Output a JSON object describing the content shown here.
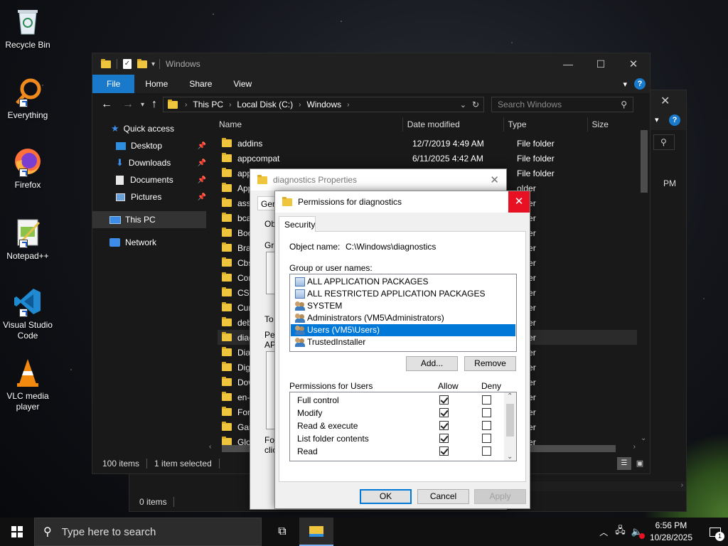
{
  "desktop": {
    "icons": [
      {
        "label": "Recycle Bin",
        "icon": "recycle-bin-icon"
      },
      {
        "label": "Everything",
        "icon": "everything-search-icon"
      },
      {
        "label": "Firefox",
        "icon": "firefox-icon"
      },
      {
        "label": "Notepad++",
        "icon": "notepadpp-icon"
      },
      {
        "label": "Visual Studio Code",
        "icon": "vscode-icon"
      },
      {
        "label": "VLC media player",
        "icon": "vlc-icon"
      }
    ]
  },
  "back_window": {
    "time_fragment": "PM",
    "status": "0 items"
  },
  "explorer": {
    "title": "Windows",
    "ribbon": {
      "file": "File",
      "home": "Home",
      "share": "Share",
      "view": "View"
    },
    "address": {
      "seg1": "This PC",
      "seg2": "Local Disk (C:)",
      "seg3": "Windows"
    },
    "search_placeholder": "Search Windows",
    "nav": {
      "quick_access": "Quick access",
      "desktop": "Desktop",
      "downloads": "Downloads",
      "documents": "Documents",
      "pictures": "Pictures",
      "this_pc": "This PC",
      "network": "Network"
    },
    "columns": {
      "name": "Name",
      "date": "Date modified",
      "type": "Type",
      "size": "Size"
    },
    "rows": [
      {
        "name": "addins",
        "date": "12/7/2019 4:49 AM",
        "type": "File folder"
      },
      {
        "name": "appcompat",
        "date": "6/11/2025 4:42 AM",
        "type": "File folder"
      },
      {
        "name": "app",
        "date": "",
        "type": "File folder"
      },
      {
        "name": "App",
        "date": "",
        "type": "older"
      },
      {
        "name": "asse",
        "date": "",
        "type": "older"
      },
      {
        "name": "bcas",
        "date": "",
        "type": "older"
      },
      {
        "name": "Boot",
        "date": "",
        "type": "older"
      },
      {
        "name": "Bran",
        "date": "",
        "type": "older"
      },
      {
        "name": "CbsT",
        "date": "",
        "type": "older"
      },
      {
        "name": "Cont",
        "date": "",
        "type": "older"
      },
      {
        "name": "CSC",
        "date": "",
        "type": "older"
      },
      {
        "name": "Curs",
        "date": "",
        "type": "older"
      },
      {
        "name": "debu",
        "date": "",
        "type": "older"
      },
      {
        "name": "diag",
        "date": "",
        "type": "older"
      },
      {
        "name": "Diag",
        "date": "",
        "type": "older"
      },
      {
        "name": "Digit",
        "date": "",
        "type": "older"
      },
      {
        "name": "Dow",
        "date": "",
        "type": "older"
      },
      {
        "name": "en-U",
        "date": "",
        "type": "older"
      },
      {
        "name": "Font",
        "date": "",
        "type": "older"
      },
      {
        "name": "Gam",
        "date": "",
        "type": "older"
      },
      {
        "name": "Glob",
        "date": "",
        "type": "older"
      }
    ],
    "status_count": "100 items",
    "status_selected": "1 item selected"
  },
  "properties": {
    "title": "diagnostics Properties",
    "tab_fragment": "Gen",
    "frag_obj": "Ob",
    "frag_gro": "Gro",
    "frag_to": "To",
    "frag_pe": "Pe",
    "frag_ap": "AP",
    "frag_fo": "Fo",
    "frag_cli": "clic"
  },
  "permissions": {
    "title": "Permissions for diagnostics",
    "tab": "Security",
    "object_label": "Object name:",
    "object_value": "C:\\Windows\\diagnostics",
    "group_label": "Group or user names:",
    "groups": [
      {
        "name": "ALL APPLICATION PACKAGES",
        "icon": "pkg"
      },
      {
        "name": "ALL RESTRICTED APPLICATION PACKAGES",
        "icon": "pkg"
      },
      {
        "name": "SYSTEM",
        "icon": "users"
      },
      {
        "name": "Administrators (VM5\\Administrators)",
        "icon": "users"
      },
      {
        "name": "Users (VM5\\Users)",
        "icon": "users"
      },
      {
        "name": "TrustedInstaller",
        "icon": "users"
      }
    ],
    "selected_group": "Users (VM5\\Users)",
    "add_button": "Add...",
    "remove_button": "Remove",
    "perm_header": "Permissions for Users",
    "allow_header": "Allow",
    "deny_header": "Deny",
    "perms": [
      {
        "name": "Full control",
        "allow": true,
        "deny": false
      },
      {
        "name": "Modify",
        "allow": true,
        "deny": false
      },
      {
        "name": "Read & execute",
        "allow": true,
        "deny": false
      },
      {
        "name": "List folder contents",
        "allow": true,
        "deny": false
      },
      {
        "name": "Read",
        "allow": true,
        "deny": false
      }
    ],
    "ok": "OK",
    "cancel": "Cancel",
    "apply": "Apply"
  },
  "taskbar": {
    "search_placeholder": "Type here to search",
    "time": "6:56 PM",
    "date": "10/28/2025",
    "notification_count": "1"
  },
  "colors": {
    "accent": "#0078d7",
    "file_tab": "#1979ca",
    "close_red": "#e81123"
  }
}
